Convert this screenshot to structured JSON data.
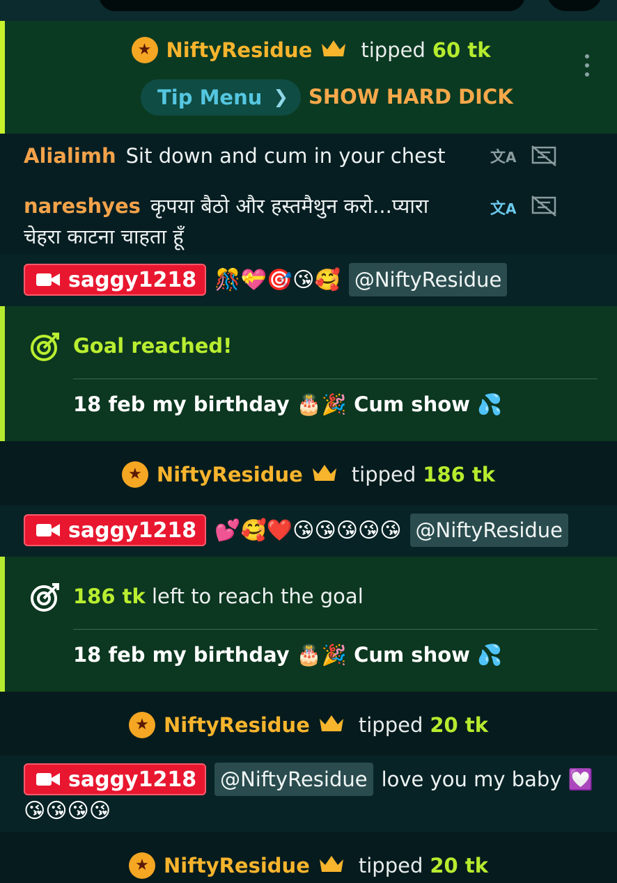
{
  "events": [
    {
      "type": "tip_highlight",
      "user": "NiftyResidue",
      "action": "tipped",
      "amount": "60 tk",
      "tip_menu_label": "Tip Menu",
      "tip_menu_item": "SHOW HARD DICK"
    },
    {
      "type": "chat",
      "user": "Alialimh",
      "text": "Sit down and cum in your chest"
    },
    {
      "type": "chat",
      "user": "nareshyes",
      "text_line1": "कृपया बैठो और हस्तमैथुन करो...प्यारा",
      "text_line2": "चेहरा काटना चाहता हूँ"
    },
    {
      "type": "broadcaster",
      "user": "saggy1218",
      "emojis": "🎊💝🎯😘🥰",
      "mention": "@NiftyResidue"
    },
    {
      "type": "goal",
      "title": "Goal reached!",
      "description": "18 feb my birthday 🎂🎉 Cum show 💦"
    },
    {
      "type": "tip",
      "user": "NiftyResidue",
      "action": "tipped",
      "amount": "186 tk"
    },
    {
      "type": "broadcaster",
      "user": "saggy1218",
      "emojis": "💕🥰❤️😘😘😘😘😘",
      "mention": "@NiftyResidue"
    },
    {
      "type": "goal_progress",
      "amount": "186 tk",
      "text": "left to reach the goal",
      "description": "18 feb my birthday 🎂🎉 Cum show 💦"
    },
    {
      "type": "tip",
      "user": "NiftyResidue",
      "action": "tipped",
      "amount": "20 tk"
    },
    {
      "type": "broadcaster",
      "user": "saggy1218",
      "mention": "@NiftyResidue",
      "text": "love you my baby 💟",
      "emojis_line2": "😘😘😘😘"
    },
    {
      "type": "tip",
      "user": "NiftyResidue",
      "action": "tipped",
      "amount": "20 tk"
    }
  ],
  "icons": {
    "star_badge": "star-icon",
    "crown": "crown-icon",
    "translate": "translate-icon",
    "hide": "hide-translation-icon",
    "camera": "video-camera-icon",
    "goal": "goal-target-icon",
    "more": "more-vertical-icon",
    "chevron": "chevron-right-icon"
  },
  "colors": {
    "tip_amount": "#b5ec2e",
    "username_vip": "#f7b42d",
    "chat_username": "#f3a24a",
    "broadcaster_badge": "#e8172f",
    "tip_menu_text": "#55c6e0",
    "tip_menu_item": "#f7a84a"
  }
}
